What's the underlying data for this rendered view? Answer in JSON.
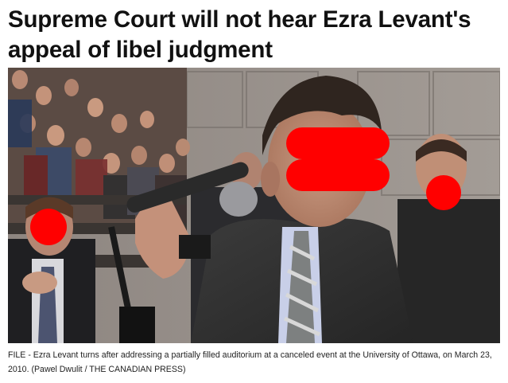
{
  "article": {
    "headline": "Supreme Court will not hear Ezra Levant's appeal of libel judgment",
    "caption": "FILE - Ezra Levant turns after addressing a partially filled auditorium at a canceled event at the University of Ottawa, on March 23, 2010. (Pawel Dwulit / THE CANADIAN PRESS)"
  },
  "colors": {
    "redaction": "#ff0000",
    "headline_text": "#111111",
    "caption_text": "#222222"
  }
}
